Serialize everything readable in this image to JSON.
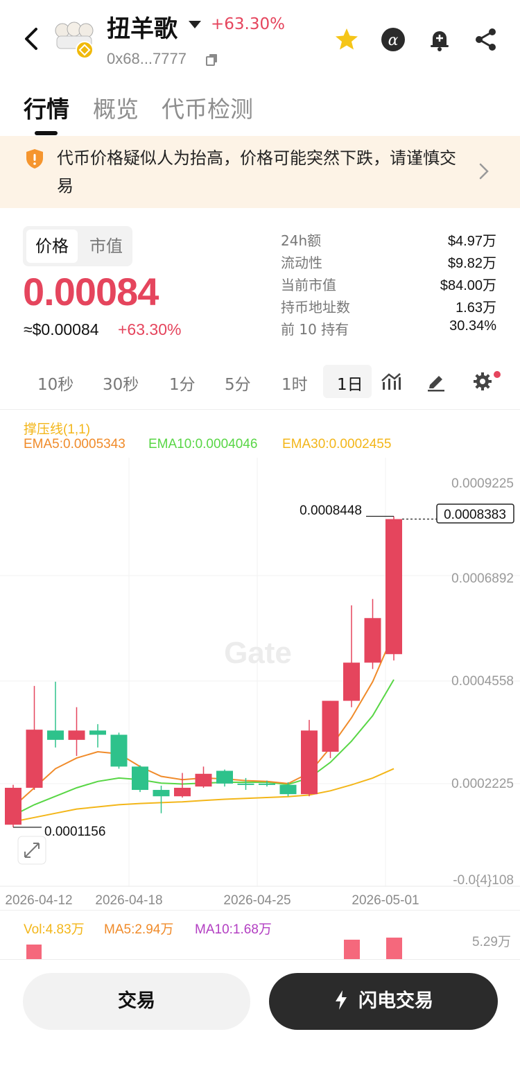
{
  "header": {
    "token_name": "扭羊歌",
    "change": "+63.30%",
    "address": "0x68...7777"
  },
  "tabs": [
    {
      "label": "行情",
      "active": true
    },
    {
      "label": "概览",
      "active": false
    },
    {
      "label": "代币检测",
      "active": false
    }
  ],
  "warning": {
    "text": "代币价格疑似人为抬高，价格可能突然下跌，请谨慎交易"
  },
  "price_panel": {
    "toggle": [
      "价格",
      "市值"
    ],
    "price": "0.00084",
    "usd_price": "≈$0.00084",
    "change": "+63.30%"
  },
  "stats": [
    {
      "label": "24h额",
      "value": "$4.97万"
    },
    {
      "label": "流动性",
      "value": "$9.82万"
    },
    {
      "label": "当前市值",
      "value": "$84.00万"
    },
    {
      "label": "持币地址数",
      "value": "1.63万"
    },
    {
      "label": "前 10 持有",
      "value": "30.34%"
    }
  ],
  "intervals": [
    "10秒",
    "30秒",
    "1分",
    "5分",
    "1时",
    "1日"
  ],
  "active_interval": "1日",
  "indicators": {
    "support": "撑压线(1,1)",
    "ema5": "EMA5:0.0005343",
    "ema10": "EMA10:0.0004046",
    "ema30": "EMA30:0.0002455"
  },
  "colors": {
    "up": "#e5455d",
    "down": "#2ec28b",
    "ema5": "#f08b2a",
    "ema10": "#58d645",
    "ema30": "#f3b619",
    "ma10": "#b23ec2"
  },
  "chart_data": {
    "type": "candlestick",
    "watermark": "Gate",
    "y_ticks": [
      "0.0009225",
      "0.0006892",
      "0.0004558",
      "0.0002225",
      "-0.0{4}108"
    ],
    "x_ticks": [
      "2026-04-12",
      "2026-04-18",
      "2026-04-25",
      "2026-05-01"
    ],
    "high_label": "0.0008448",
    "low_label": "0.0001156",
    "last_price_label": "0.0008383",
    "candles": [
      {
        "o": 0.000118,
        "c": 0.000205,
        "h": 0.000212,
        "l": 0.000112
      },
      {
        "o": 0.000205,
        "c": 0.000342,
        "h": 0.000445,
        "l": 0.0002
      },
      {
        "o": 0.00034,
        "c": 0.000318,
        "h": 0.000455,
        "l": 0.0003
      },
      {
        "o": 0.000318,
        "c": 0.00034,
        "h": 0.000395,
        "l": 0.00028
      },
      {
        "o": 0.00034,
        "c": 0.00033,
        "h": 0.000355,
        "l": 0.0003
      },
      {
        "o": 0.00033,
        "c": 0.000255,
        "h": 0.000335,
        "l": 0.00025
      },
      {
        "o": 0.000255,
        "c": 0.0002,
        "h": 0.000258,
        "l": 0.000195
      },
      {
        "o": 0.0002,
        "c": 0.000185,
        "h": 0.00021,
        "l": 0.000145
      },
      {
        "o": 0.000185,
        "c": 0.000205,
        "h": 0.00024,
        "l": 0.000182
      },
      {
        "o": 0.000208,
        "c": 0.000238,
        "h": 0.000255,
        "l": 0.000205
      },
      {
        "o": 0.000245,
        "c": 0.000215,
        "h": 0.000248,
        "l": 0.000208
      },
      {
        "o": 0.000215,
        "c": 0.000213,
        "h": 0.000228,
        "l": 0.0002
      },
      {
        "o": 0.000215,
        "c": 0.000212,
        "h": 0.000222,
        "l": 0.000208
      },
      {
        "o": 0.000212,
        "c": 0.00019,
        "h": 0.000218,
        "l": 0.000185
      },
      {
        "o": 0.00019,
        "c": 0.00034,
        "h": 0.000365,
        "l": 0.000185
      },
      {
        "o": 0.00029,
        "c": 0.00041,
        "h": 0.00041,
        "l": 0.000275
      },
      {
        "o": 0.00041,
        "c": 0.0005,
        "h": 0.000635,
        "l": 0.000395
      },
      {
        "o": 0.0005,
        "c": 0.000605,
        "h": 0.00065,
        "l": 0.000485
      },
      {
        "o": 0.00052,
        "c": 0.0008383,
        "h": 0.0008448,
        "l": 0.000505
      }
    ],
    "ema5": [
      0.00016,
      0.000205,
      0.00025,
      0.000275,
      0.00029,
      0.000285,
      0.000255,
      0.000232,
      0.000224,
      0.000228,
      0.000226,
      0.000222,
      0.00022,
      0.000215,
      0.00024,
      0.0003,
      0.00037,
      0.000455,
      0.00057
    ],
    "ema10": [
      0.00014,
      0.000165,
      0.000185,
      0.000205,
      0.00022,
      0.000228,
      0.000224,
      0.000216,
      0.000214,
      0.000216,
      0.000218,
      0.000218,
      0.000218,
      0.000213,
      0.000228,
      0.000265,
      0.000315,
      0.000375,
      0.00046
    ],
    "ema30": [
      0.000125,
      0.000135,
      0.000145,
      0.000155,
      0.00016,
      0.000165,
      0.000168,
      0.00017,
      0.000172,
      0.000175,
      0.000178,
      0.00018,
      0.000182,
      0.000184,
      0.000188,
      0.000198,
      0.000212,
      0.000228,
      0.00025
    ]
  },
  "volume": {
    "vol": "Vol:4.83万",
    "ma5": "MA5:2.94万",
    "ma10": "MA10:1.68万",
    "max_label": "5.29万"
  },
  "bottom": {
    "trade": "交易",
    "flash_trade": "闪电交易"
  }
}
